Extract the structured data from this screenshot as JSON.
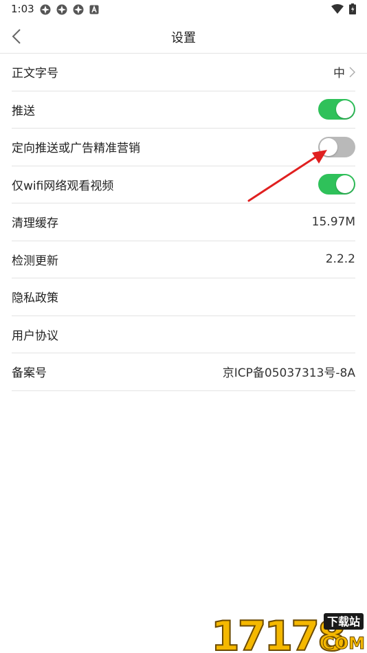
{
  "status_bar": {
    "time": "1:03",
    "left_icons": [
      "app-notification-icon",
      "app-notification-icon",
      "app-notification-icon",
      "a-badge-icon"
    ],
    "right_icons": [
      "wifi-icon",
      "battery-charging-icon"
    ]
  },
  "header": {
    "back_icon": "chevron-left-icon",
    "title": "设置"
  },
  "settings": [
    {
      "id": "font-size",
      "label": "正文字号",
      "value": "中",
      "type": "select"
    },
    {
      "id": "push",
      "label": "推送",
      "type": "toggle",
      "on": true
    },
    {
      "id": "targeted-ads",
      "label": "定向推送或广告精准营销",
      "type": "toggle",
      "on": false
    },
    {
      "id": "wifi-video",
      "label": "仅wifi网络观看视频",
      "type": "toggle",
      "on": true
    },
    {
      "id": "clear-cache",
      "label": "清理缓存",
      "value": "15.97M",
      "type": "value"
    },
    {
      "id": "check-update",
      "label": "检测更新",
      "value": "2.2.2",
      "type": "value"
    },
    {
      "id": "privacy-policy",
      "label": "隐私政策",
      "type": "link"
    },
    {
      "id": "user-agreement",
      "label": "用户协议",
      "type": "link"
    },
    {
      "id": "icp",
      "label": "备案号",
      "value": "京ICP备05037313号-8A",
      "type": "value"
    }
  ],
  "colors": {
    "toggle_on": "#2fc15a",
    "toggle_off": "#b9b9b9",
    "annotation_arrow": "#e02020",
    "divider": "#e3e3e3"
  },
  "watermark": {
    "number": "17178",
    "tag": "下载站",
    "domain": "COM"
  }
}
